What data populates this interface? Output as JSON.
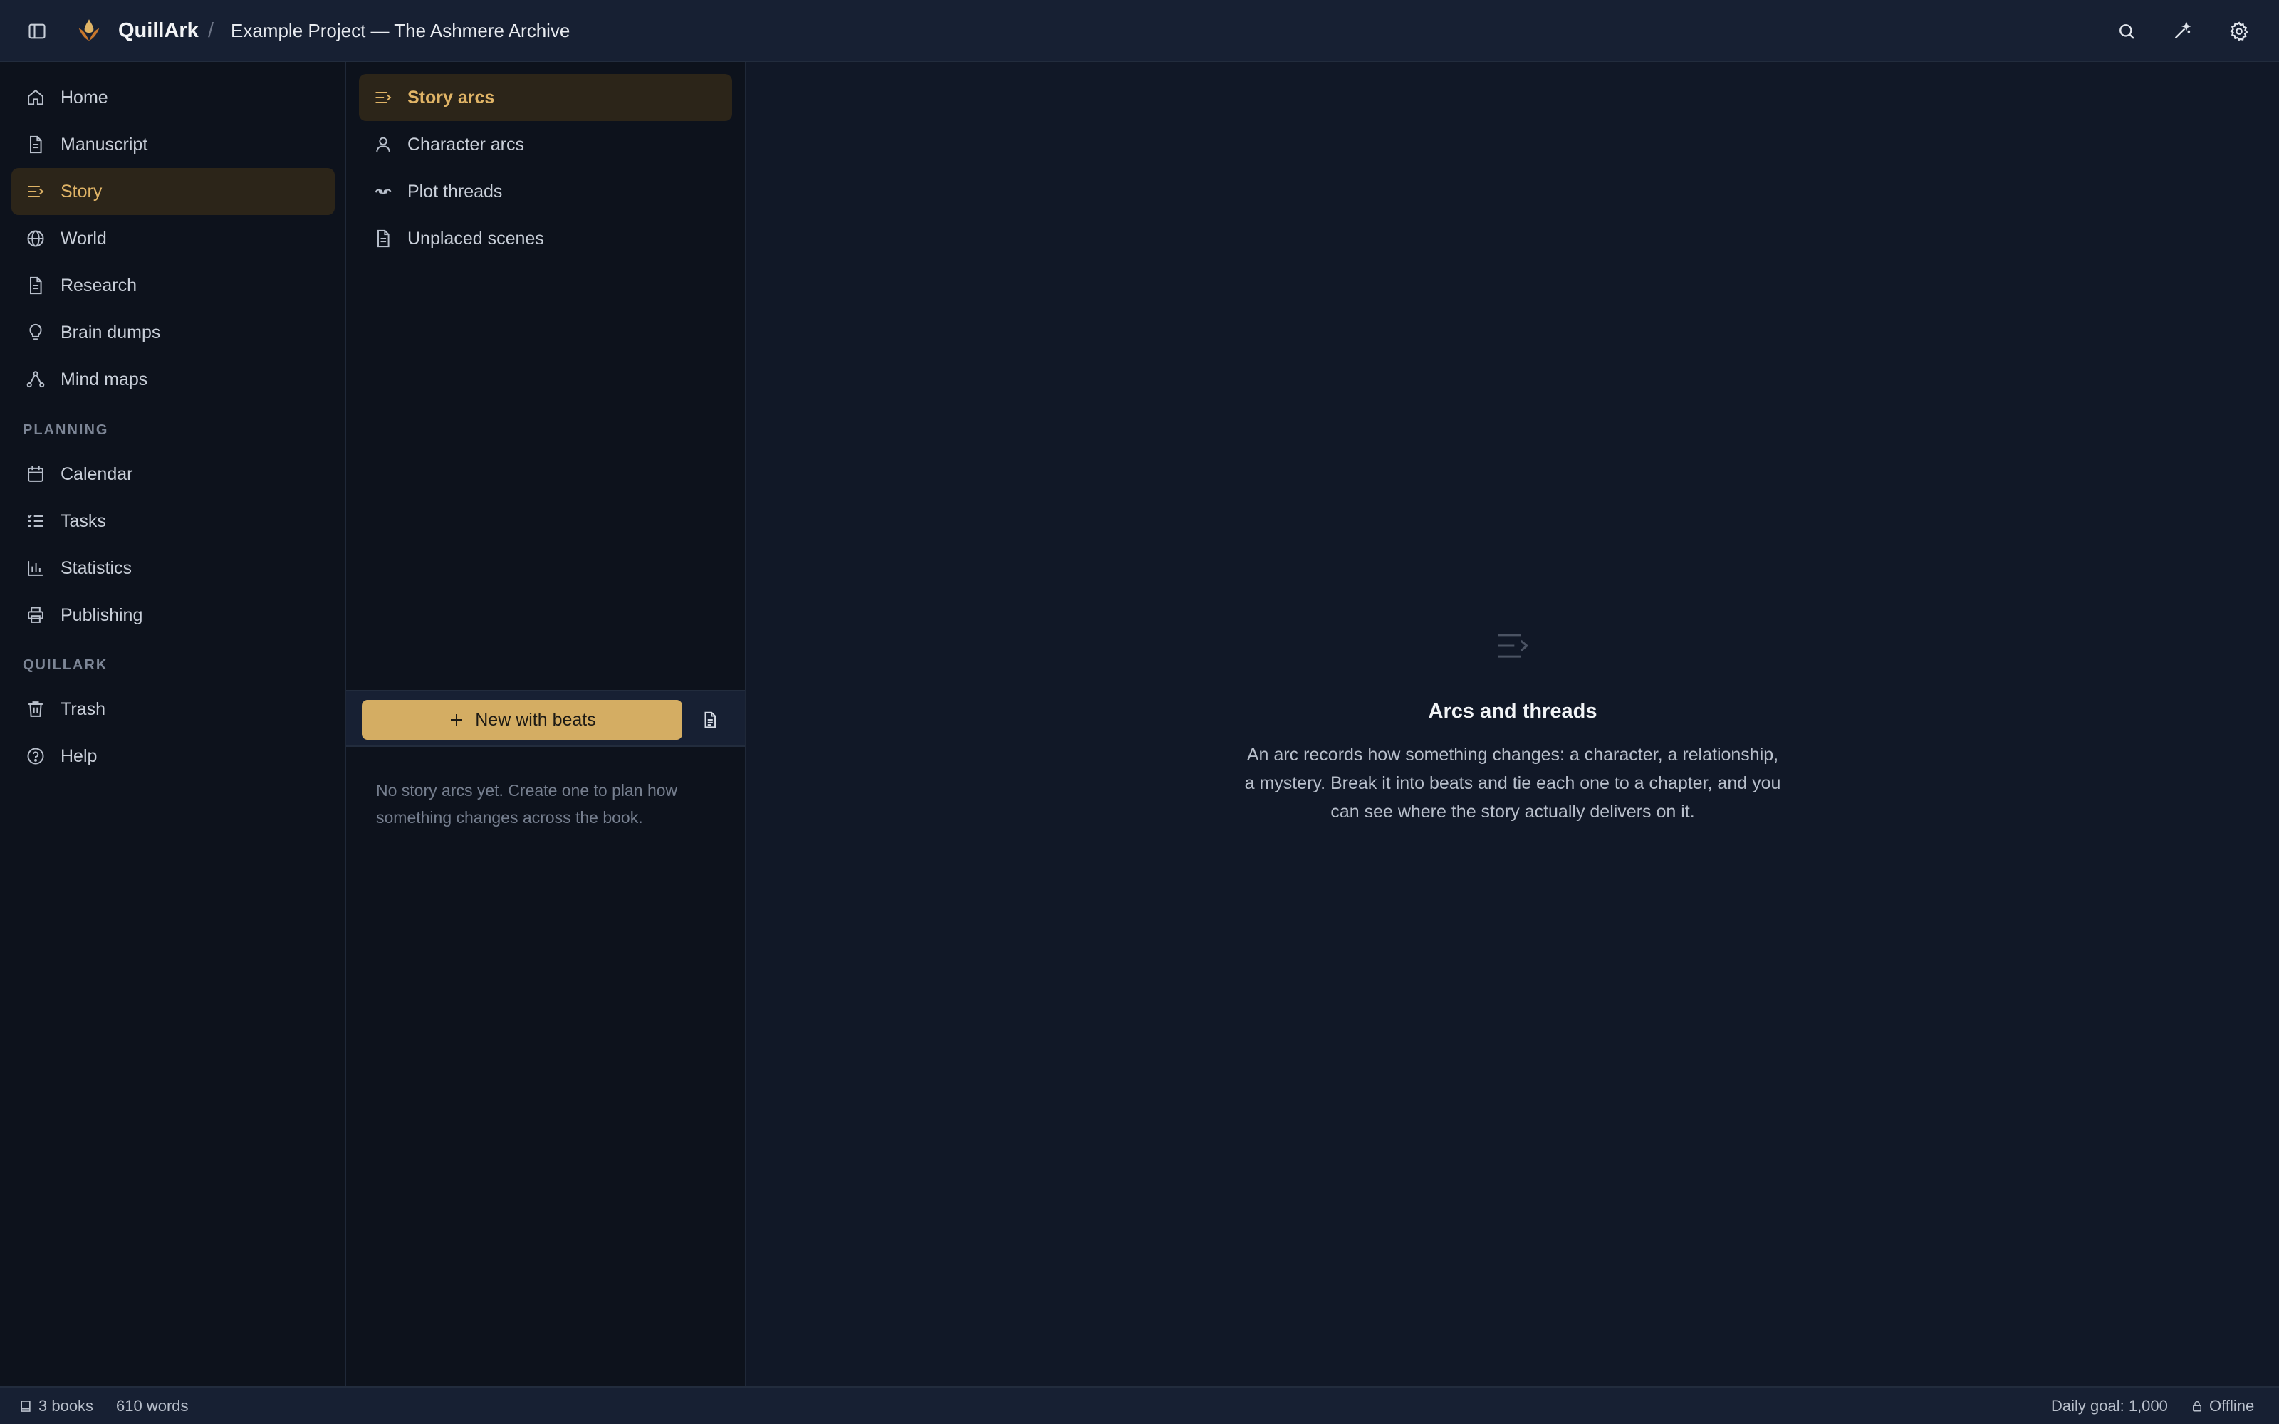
{
  "header": {
    "app_name": "QuillArk",
    "separator": "/",
    "project_title": "Example Project — The Ashmere Archive",
    "icons": [
      "sidebar-toggle-icon",
      "quillark-logo",
      "search-icon",
      "magic-wand-icon",
      "gear-icon"
    ]
  },
  "sidebar": {
    "items": [
      {
        "label": "Home",
        "icon": "home-icon"
      },
      {
        "label": "Manuscript",
        "icon": "document-icon"
      },
      {
        "label": "Story",
        "icon": "story-lines-icon",
        "active": true
      },
      {
        "label": "World",
        "icon": "globe-icon"
      },
      {
        "label": "Research",
        "icon": "document-icon"
      },
      {
        "label": "Brain dumps",
        "icon": "lightbulb-icon"
      },
      {
        "label": "Mind maps",
        "icon": "mind-map-icon"
      }
    ],
    "planning_label": "PLANNING",
    "planning_items": [
      {
        "label": "Calendar",
        "icon": "calendar-icon"
      },
      {
        "label": "Tasks",
        "icon": "tasks-icon"
      },
      {
        "label": "Statistics",
        "icon": "bar-chart-icon"
      },
      {
        "label": "Publishing",
        "icon": "printer-icon"
      }
    ],
    "quillark_label": "QUILLARK",
    "quillark_items": [
      {
        "label": "Trash",
        "icon": "trash-icon"
      },
      {
        "label": "Help",
        "icon": "help-icon"
      }
    ]
  },
  "story_panel": {
    "items": [
      {
        "label": "Story arcs",
        "icon": "story-lines-icon",
        "active": true
      },
      {
        "label": "Character arcs",
        "icon": "person-icon"
      },
      {
        "label": "Plot threads",
        "icon": "thread-icon"
      },
      {
        "label": "Unplaced scenes",
        "icon": "document-icon"
      }
    ],
    "new_button_label": "New with beats",
    "empty_hint": "No story arcs yet. Create one to plan how something changes across the book."
  },
  "main": {
    "empty_title": "Arcs and threads",
    "empty_description": "An arc records how something changes: a character, a relationship, a mystery. Break it into beats and tie each one to a chapter, and you can see where the story actually delivers on it."
  },
  "status": {
    "books": "3 books",
    "words": "610 words",
    "daily_goal": "Daily goal: 1,000",
    "connection": "Offline"
  },
  "colors": {
    "accent": "#e0b466",
    "button": "#d4ad63",
    "active_bg": "#2c2519",
    "bg_main": "#111827",
    "bg_panel": "#0d121c",
    "bg_bar": "#172033"
  }
}
